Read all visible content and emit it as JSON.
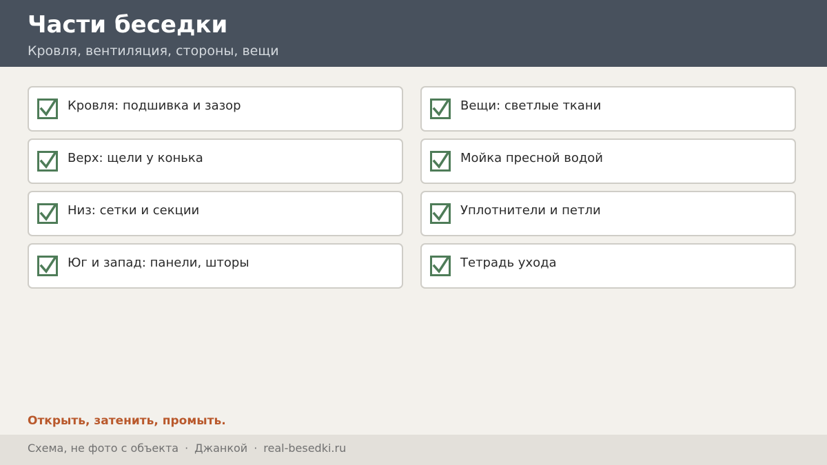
{
  "header": {
    "title": "Части беседки",
    "subtitle": "Кровля, вентиляция, стороны, вещи"
  },
  "checklist": {
    "check_icon": "checkbox-checked-icon",
    "check_color": "#4e7c58",
    "left": [
      {
        "label": "Кровля: подшивка и зазор",
        "checked": true
      },
      {
        "label": "Верх: щели у конька",
        "checked": true
      },
      {
        "label": "Низ: сетки и секции",
        "checked": true
      },
      {
        "label": "Юг и запад: панели, шторы",
        "checked": true
      }
    ],
    "right": [
      {
        "label": "Вещи: светлые ткани",
        "checked": true
      },
      {
        "label": "Мойка пресной водой",
        "checked": true
      },
      {
        "label": "Уплотнители и петли",
        "checked": true
      },
      {
        "label": "Тетрадь ухода",
        "checked": true
      }
    ]
  },
  "callout": {
    "text": "Открыть, затенить, промыть.",
    "color": "#b9592c"
  },
  "footer": {
    "note": "Схема, не фото с объекта",
    "separator": "·",
    "city": "Джанкой",
    "site": "real-besedki.ru"
  }
}
